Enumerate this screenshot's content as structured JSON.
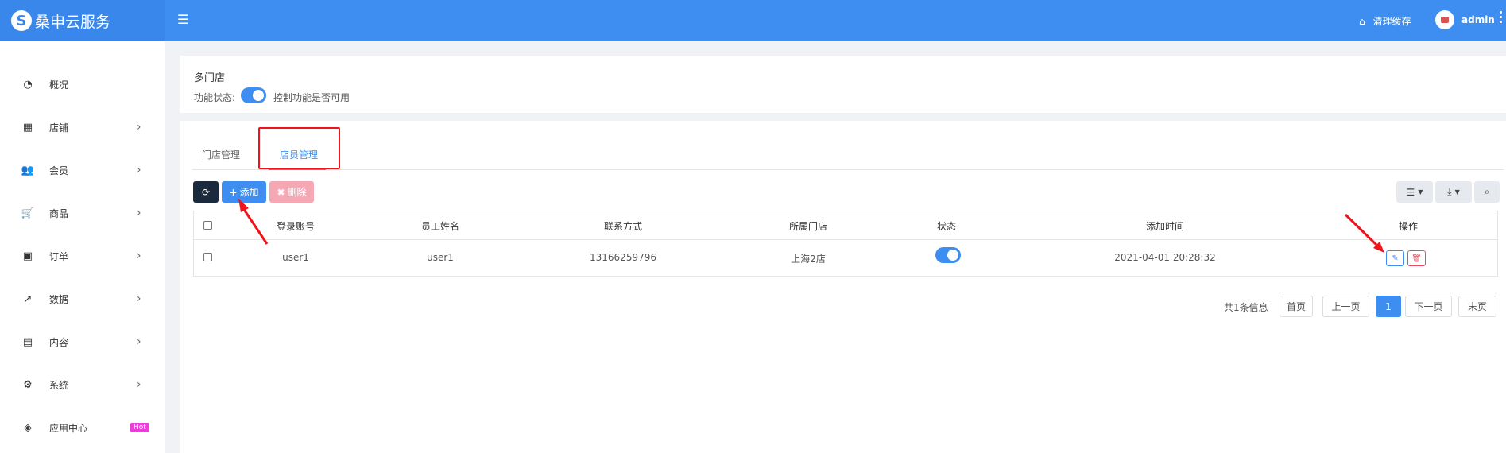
{
  "brand": {
    "logo_letter": "S",
    "name": "桑申云服务"
  },
  "topbar": {
    "menu_icon": "☰",
    "clear_cache": "清理缓存",
    "user": "admin"
  },
  "sidebar": {
    "items": [
      {
        "label": "概况",
        "icon": "dashboard-icon",
        "glyph": "◔",
        "arrow": ""
      },
      {
        "label": "店铺",
        "icon": "grid-icon",
        "glyph": "▦",
        "arrow": "›"
      },
      {
        "label": "会员",
        "icon": "users-icon",
        "glyph": "👥",
        "arrow": "›"
      },
      {
        "label": "商品",
        "icon": "cart-icon",
        "glyph": "🛒",
        "arrow": "›"
      },
      {
        "label": "订单",
        "icon": "money-icon",
        "glyph": "▣",
        "arrow": "›"
      },
      {
        "label": "数据",
        "icon": "chart-icon",
        "glyph": "↗",
        "arrow": "›"
      },
      {
        "label": "内容",
        "icon": "document-icon",
        "glyph": "▤",
        "arrow": "›"
      },
      {
        "label": "系统",
        "icon": "gear-icon",
        "glyph": "⚙",
        "arrow": "›"
      },
      {
        "label": "应用中心",
        "icon": "cube-icon",
        "glyph": "◈",
        "arrow": "",
        "badge": "Hot"
      }
    ]
  },
  "feature": {
    "title": "多门店",
    "status_label": "功能状态:",
    "enabled": true,
    "hint": "控制功能是否可用"
  },
  "tabs": [
    {
      "label": "门店管理",
      "active": false
    },
    {
      "label": "店员管理",
      "active": true
    }
  ],
  "toolbar": {
    "add_label": "添加",
    "delete_label": "删除"
  },
  "table": {
    "columns": [
      "登录账号",
      "员工姓名",
      "联系方式",
      "所属门店",
      "状态",
      "添加时间",
      "操作"
    ],
    "rows": [
      {
        "account": "user1",
        "name": "user1",
        "phone": "13166259796",
        "store": "上海2店",
        "status": true,
        "added": "2021-04-01 20:28:32"
      }
    ]
  },
  "pagination": {
    "info": "共1条信息",
    "first": "首页",
    "prev": "上一页",
    "current": "1",
    "next": "下一页",
    "last": "末页"
  },
  "colors": {
    "accent": "#3d8ef0",
    "danger": "#e64b5f",
    "annotation": "#f0131b"
  }
}
